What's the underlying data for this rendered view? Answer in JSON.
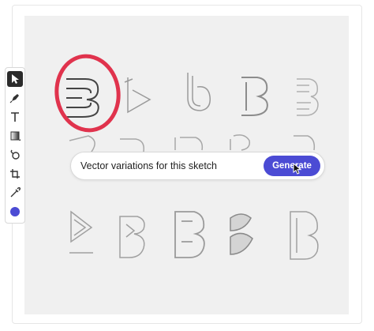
{
  "prompt": {
    "text": "Vector variations for this sketch",
    "button_label": "Generate"
  },
  "toolbar": {
    "tools": [
      "select-tool",
      "pen-tool",
      "text-tool",
      "gradient-tool",
      "shape-builder-tool",
      "artboard-tool",
      "eyedropper-tool",
      "color-swatch"
    ]
  },
  "colors": {
    "accent": "#4b4bd4",
    "selection_circle": "#e0334d",
    "swatch": "#4b4bd4",
    "canvas": "#f0f0f0"
  }
}
